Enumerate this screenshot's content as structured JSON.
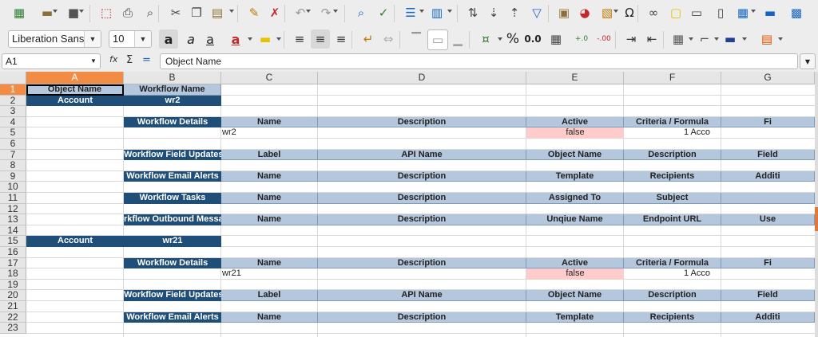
{
  "toolbar1": {
    "buttons": [
      {
        "name": "new-icon",
        "glyph": "▦",
        "color": "#2e7d32"
      },
      {
        "name": "open-icon",
        "glyph": "▬",
        "color": "#8d6e3a"
      },
      {
        "name": "save-icon",
        "glyph": "■",
        "color": "#555555"
      },
      {
        "name": "export-pdf-icon",
        "glyph": "⬚",
        "color": "#c62828"
      },
      {
        "name": "print-icon",
        "glyph": "⎙",
        "color": "#444444"
      },
      {
        "name": "print-preview-icon",
        "glyph": "⌕",
        "color": "#444444"
      },
      {
        "name": "cut-icon",
        "glyph": "✂",
        "color": "#444444"
      },
      {
        "name": "copy-icon",
        "glyph": "❐",
        "color": "#444444"
      },
      {
        "name": "paste-icon",
        "glyph": "▤",
        "color": "#8d6e3a"
      },
      {
        "name": "clone-formatting-icon",
        "glyph": "✎",
        "color": "#c17a00"
      },
      {
        "name": "clear-formatting-icon",
        "glyph": "✗",
        "color": "#c62828"
      },
      {
        "name": "undo-icon",
        "glyph": "↶",
        "color": "#999999"
      },
      {
        "name": "redo-icon",
        "glyph": "↷",
        "color": "#999999"
      },
      {
        "name": "find-replace-icon",
        "glyph": "⌕",
        "color": "#1565c0"
      },
      {
        "name": "spelling-icon",
        "glyph": "✓",
        "color": "#2e7d32"
      },
      {
        "name": "row-icon",
        "glyph": "☰",
        "color": "#1565c0"
      },
      {
        "name": "column-icon",
        "glyph": "▥",
        "color": "#1565c0"
      },
      {
        "name": "sort-icon",
        "glyph": "⇅",
        "color": "#444444"
      },
      {
        "name": "sort-ascending-icon",
        "glyph": "⇣",
        "color": "#444444"
      },
      {
        "name": "sort-descending-icon",
        "glyph": "⇡",
        "color": "#444444"
      },
      {
        "name": "autofilter-icon",
        "glyph": "▽",
        "color": "#1565c0"
      },
      {
        "name": "insert-image-icon",
        "glyph": "▣",
        "color": "#8d6e3a"
      },
      {
        "name": "insert-chart-icon",
        "glyph": "◕",
        "color": "#c62828"
      },
      {
        "name": "pivot-table-icon",
        "glyph": "▧",
        "color": "#c17a00"
      },
      {
        "name": "special-character-icon",
        "glyph": "Ω",
        "color": "#222222"
      },
      {
        "name": "hyperlink-icon",
        "glyph": "∞",
        "color": "#444444"
      },
      {
        "name": "comment-icon",
        "glyph": "▢",
        "color": "#e6c200"
      },
      {
        "name": "header-footer-icon",
        "glyph": "▭",
        "color": "#444444"
      },
      {
        "name": "define-print-area-icon",
        "glyph": "▯",
        "color": "#444444"
      },
      {
        "name": "freeze-rows-columns-icon",
        "glyph": "▦",
        "color": "#1565c0"
      },
      {
        "name": "split-window-icon",
        "glyph": "▬",
        "color": "#1565c0"
      },
      {
        "name": "show-draw-functions-icon",
        "glyph": "▩",
        "color": "#1565c0"
      }
    ]
  },
  "toolbar2": {
    "font_name": "Liberation Sans",
    "font_size": "10",
    "buttons": [
      {
        "name": "bold-icon",
        "glyph": "a",
        "color": "#222222"
      },
      {
        "name": "italic-icon",
        "glyph": "a",
        "color": "#222222"
      },
      {
        "name": "underline-icon",
        "glyph": "a",
        "color": "#222222"
      },
      {
        "name": "font-color-icon",
        "glyph": "a",
        "color": "#c62828"
      },
      {
        "name": "highlight-color-icon",
        "glyph": "▬",
        "color": "#e6c200"
      },
      {
        "name": "align-left-icon",
        "glyph": "≡",
        "color": "#333333"
      },
      {
        "name": "align-center-icon",
        "glyph": "≡",
        "color": "#333333"
      },
      {
        "name": "align-right-icon",
        "glyph": "≡",
        "color": "#333333"
      },
      {
        "name": "wrap-text-icon",
        "glyph": "↵",
        "color": "#c17a00"
      },
      {
        "name": "merge-center-icon",
        "glyph": "⇔",
        "color": "#aaaaaa"
      },
      {
        "name": "align-top-icon",
        "glyph": "▔",
        "color": "#999999"
      },
      {
        "name": "align-middle-icon",
        "glyph": "▭",
        "color": "#999999"
      },
      {
        "name": "align-bottom-icon",
        "glyph": "▁",
        "color": "#999999"
      },
      {
        "name": "currency-format-icon",
        "glyph": "¤",
        "color": "#2e7d32"
      },
      {
        "name": "percent-format-icon",
        "glyph": "%",
        "color": "#222222"
      },
      {
        "name": "number-format-icon",
        "glyph": "0.0",
        "color": "#222222"
      },
      {
        "name": "date-format-icon",
        "glyph": "▦",
        "color": "#444444"
      },
      {
        "name": "add-decimal-icon",
        "glyph": "+.0",
        "color": "#2e7d32"
      },
      {
        "name": "delete-decimal-icon",
        "glyph": "-.00",
        "color": "#c62828"
      },
      {
        "name": "increase-indent-icon",
        "glyph": "⇥",
        "color": "#333333"
      },
      {
        "name": "decrease-indent-icon",
        "glyph": "⇤",
        "color": "#333333"
      },
      {
        "name": "borders-icon",
        "glyph": "▦",
        "color": "#555555"
      },
      {
        "name": "border-style-icon",
        "glyph": "⌐",
        "color": "#555555"
      },
      {
        "name": "border-color-icon",
        "glyph": "▬",
        "color": "#1f3f8f"
      },
      {
        "name": "conditional-format-icon",
        "glyph": "▤",
        "color": "#e65100"
      }
    ]
  },
  "formula_bar": {
    "name_box": "A1",
    "function_wizard_icon": "fx-icon",
    "sum_glyph": "Σ",
    "equals_glyph": "=",
    "content": "Object Name"
  },
  "grid": {
    "columns": [
      "A",
      "B",
      "C",
      "D",
      "E",
      "F",
      "G"
    ],
    "rows": [
      "1",
      "2",
      "3",
      "4",
      "5",
      "6",
      "7",
      "8",
      "9",
      "10",
      "11",
      "12",
      "13",
      "14",
      "15",
      "16",
      "17",
      "18",
      "19",
      "20",
      "21",
      "22",
      "23"
    ],
    "selected_column": "A",
    "selected_row": "1",
    "cells": [
      {
        "r": 1,
        "c": 0,
        "text": "Object Name",
        "style": "hdr",
        "active": true
      },
      {
        "r": 1,
        "c": 1,
        "text": "Workflow Name",
        "style": "hdr"
      },
      {
        "r": 2,
        "c": 0,
        "text": "Account",
        "style": "dark"
      },
      {
        "r": 2,
        "c": 1,
        "text": "wr2",
        "style": "dark"
      },
      {
        "r": 4,
        "c": 1,
        "text": "Workflow Details",
        "style": "dark"
      },
      {
        "r": 4,
        "c": 2,
        "text": "Name",
        "style": "hdr"
      },
      {
        "r": 4,
        "c": 3,
        "text": "Description",
        "style": "hdr"
      },
      {
        "r": 4,
        "c": 4,
        "text": "Active",
        "style": "hdr"
      },
      {
        "r": 4,
        "c": 5,
        "text": "Criteria / Formula",
        "style": "hdr"
      },
      {
        "r": 4,
        "c": 6,
        "text": "Fi",
        "style": "hdr"
      },
      {
        "r": 5,
        "c": 2,
        "text": "wr2",
        "style": "plain"
      },
      {
        "r": 5,
        "c": 4,
        "text": "false",
        "style": "pink"
      },
      {
        "r": 5,
        "c": 5,
        "text": "1  Acco",
        "style": "right"
      },
      {
        "r": 7,
        "c": 1,
        "text": "Workflow Field Updates",
        "style": "dark"
      },
      {
        "r": 7,
        "c": 2,
        "text": "Label",
        "style": "hdr"
      },
      {
        "r": 7,
        "c": 3,
        "text": "API Name",
        "style": "hdr"
      },
      {
        "r": 7,
        "c": 4,
        "text": "Object Name",
        "style": "hdr"
      },
      {
        "r": 7,
        "c": 5,
        "text": "Description",
        "style": "hdr"
      },
      {
        "r": 7,
        "c": 6,
        "text": "Field",
        "style": "hdr"
      },
      {
        "r": 9,
        "c": 1,
        "text": "Workflow Email Alerts",
        "style": "dark"
      },
      {
        "r": 9,
        "c": 2,
        "text": "Name",
        "style": "hdr"
      },
      {
        "r": 9,
        "c": 3,
        "text": "Description",
        "style": "hdr"
      },
      {
        "r": 9,
        "c": 4,
        "text": "Template",
        "style": "hdr"
      },
      {
        "r": 9,
        "c": 5,
        "text": "Recipients",
        "style": "hdr"
      },
      {
        "r": 9,
        "c": 6,
        "text": "Additi",
        "style": "hdr"
      },
      {
        "r": 11,
        "c": 1,
        "text": "Workflow Tasks",
        "style": "dark"
      },
      {
        "r": 11,
        "c": 2,
        "text": "Name",
        "style": "hdr"
      },
      {
        "r": 11,
        "c": 3,
        "text": "Description",
        "style": "hdr"
      },
      {
        "r": 11,
        "c": 4,
        "text": "Assigned To",
        "style": "hdr"
      },
      {
        "r": 11,
        "c": 5,
        "text": "Subject",
        "style": "hdr"
      },
      {
        "r": 11,
        "c": 6,
        "text": "",
        "style": "hdr"
      },
      {
        "r": 13,
        "c": 1,
        "text": "rkflow Outbound Messa",
        "style": "dark"
      },
      {
        "r": 13,
        "c": 2,
        "text": "Name",
        "style": "hdr"
      },
      {
        "r": 13,
        "c": 3,
        "text": "Description",
        "style": "hdr"
      },
      {
        "r": 13,
        "c": 4,
        "text": "Unqiue Name",
        "style": "hdr"
      },
      {
        "r": 13,
        "c": 5,
        "text": "Endpoint URL",
        "style": "hdr"
      },
      {
        "r": 13,
        "c": 6,
        "text": "Use",
        "style": "hdr"
      },
      {
        "r": 15,
        "c": 0,
        "text": "Account",
        "style": "dark"
      },
      {
        "r": 15,
        "c": 1,
        "text": "wr21",
        "style": "dark"
      },
      {
        "r": 17,
        "c": 1,
        "text": "Workflow Details",
        "style": "dark"
      },
      {
        "r": 17,
        "c": 2,
        "text": "Name",
        "style": "hdr"
      },
      {
        "r": 17,
        "c": 3,
        "text": "Description",
        "style": "hdr"
      },
      {
        "r": 17,
        "c": 4,
        "text": "Active",
        "style": "hdr"
      },
      {
        "r": 17,
        "c": 5,
        "text": "Criteria / Formula",
        "style": "hdr"
      },
      {
        "r": 17,
        "c": 6,
        "text": "Fi",
        "style": "hdr"
      },
      {
        "r": 18,
        "c": 2,
        "text": "wr21",
        "style": "plain"
      },
      {
        "r": 18,
        "c": 4,
        "text": "false",
        "style": "pink"
      },
      {
        "r": 18,
        "c": 5,
        "text": "1  Acco",
        "style": "right"
      },
      {
        "r": 20,
        "c": 1,
        "text": "Workflow Field Updates",
        "style": "dark"
      },
      {
        "r": 20,
        "c": 2,
        "text": "Label",
        "style": "hdr"
      },
      {
        "r": 20,
        "c": 3,
        "text": "API Name",
        "style": "hdr"
      },
      {
        "r": 20,
        "c": 4,
        "text": "Object Name",
        "style": "hdr"
      },
      {
        "r": 20,
        "c": 5,
        "text": "Description",
        "style": "hdr"
      },
      {
        "r": 20,
        "c": 6,
        "text": "Field",
        "style": "hdr"
      },
      {
        "r": 22,
        "c": 1,
        "text": "Workflow Email Alerts",
        "style": "dark"
      },
      {
        "r": 22,
        "c": 2,
        "text": "Name",
        "style": "hdr"
      },
      {
        "r": 22,
        "c": 3,
        "text": "Description",
        "style": "hdr"
      },
      {
        "r": 22,
        "c": 4,
        "text": "Template",
        "style": "hdr"
      },
      {
        "r": 22,
        "c": 5,
        "text": "Recipients",
        "style": "hdr"
      },
      {
        "r": 22,
        "c": 6,
        "text": "Additi",
        "style": "hdr"
      }
    ]
  }
}
